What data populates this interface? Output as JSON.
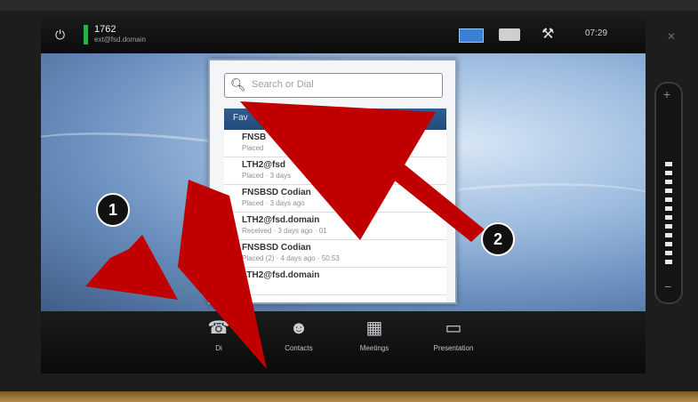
{
  "status": {
    "extension": "1762",
    "uri": "ext@fsd.domain",
    "time": "07:29",
    "icons": [
      "power-icon",
      "layout-icon",
      "camera-icon",
      "tools-icon",
      "mic-off-icon"
    ]
  },
  "search": {
    "placeholder": "Search or Dial"
  },
  "tabs": {
    "favorites": "Fav"
  },
  "calls": [
    {
      "name": "FNSB",
      "detail": "Placed"
    },
    {
      "name": "LTH2@fsd",
      "detail": "Placed · 3 days"
    },
    {
      "name": "FNSBSD Codian",
      "detail": "Placed · 3 days ago"
    },
    {
      "name": "LTH2@fsd.domain",
      "detail": "Received · 3 days ago · 01"
    },
    {
      "name": "FNSBSD Codian",
      "detail": "Placed (2) · 4 days ago · 50:53"
    },
    {
      "name": "LTH2@fsd.domain",
      "detail": ""
    }
  ],
  "dock": [
    {
      "label": "Di",
      "icon": "dial-icon"
    },
    {
      "label": "Contacts",
      "icon": "contacts-icon"
    },
    {
      "label": "Meetings",
      "icon": "meetings-icon"
    },
    {
      "label": "Presentation",
      "icon": "presentation-icon"
    }
  ],
  "annotations": {
    "badge1": "1",
    "badge2": "2",
    "arrow_color": "#c00000"
  },
  "colors": {
    "status_green": "#29b04a",
    "header_blue": "#2f5e93",
    "layout_blue": "#3a7fd8"
  }
}
